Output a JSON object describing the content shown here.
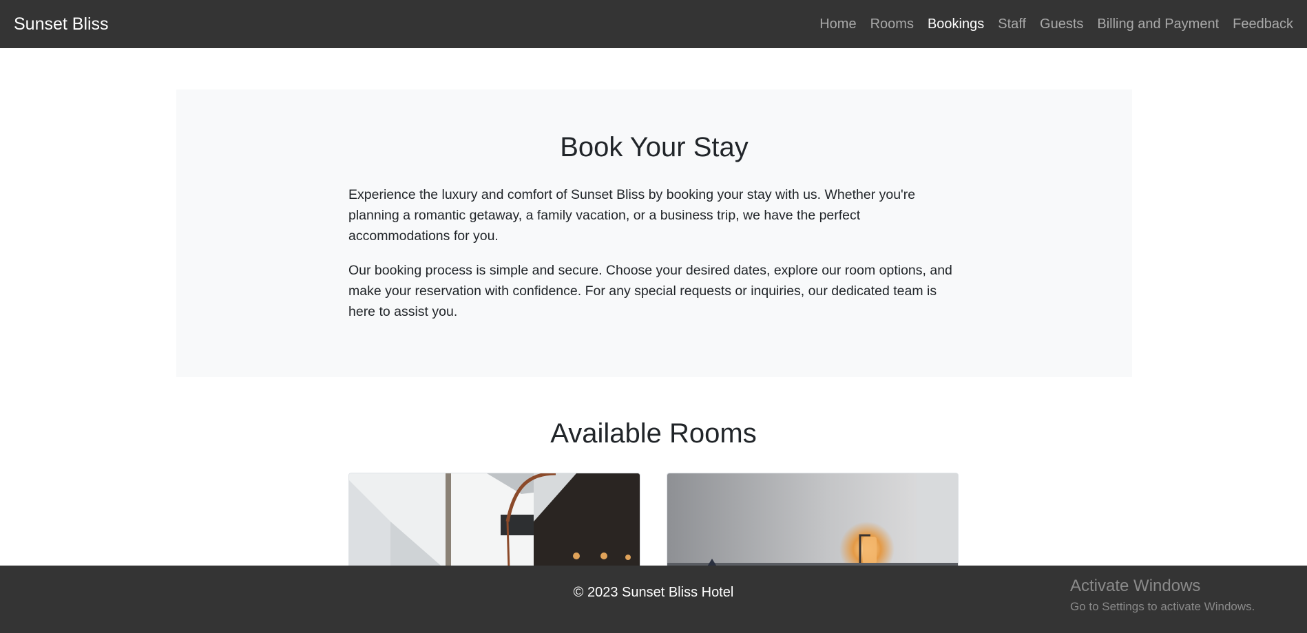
{
  "navbar": {
    "brand": "Sunset Bliss",
    "links": [
      {
        "label": "Home"
      },
      {
        "label": "Rooms"
      },
      {
        "label": "Bookings"
      },
      {
        "label": "Staff"
      },
      {
        "label": "Guests"
      },
      {
        "label": "Billing and Payment"
      },
      {
        "label": "Feedback"
      }
    ],
    "active": "Bookings"
  },
  "hero": {
    "title": "Book Your Stay",
    "paragraph1": "Experience the luxury and comfort of Sunset Bliss by booking your stay with us. Whether you're planning a romantic getaway, a family vacation, or a business trip, we have the perfect accommodations for you.",
    "paragraph2": "Our booking process is simple and secure. Choose your desired dates, explore our room options, and make your reservation with confidence. For any special requests or inquiries, our dedicated team is here to assist you."
  },
  "rooms": {
    "title": "Available Rooms"
  },
  "footer": {
    "text": "© 2023 Sunset Bliss Hotel"
  },
  "watermark": {
    "title": "Activate Windows",
    "subtitle": "Go to Settings to activate Windows."
  },
  "colors": {
    "navbar_bg": "#343434",
    "nav_inactive": "#a9a9a9",
    "nav_active": "#ffffff",
    "hero_bg": "#f8f9fa",
    "text": "#212529"
  }
}
